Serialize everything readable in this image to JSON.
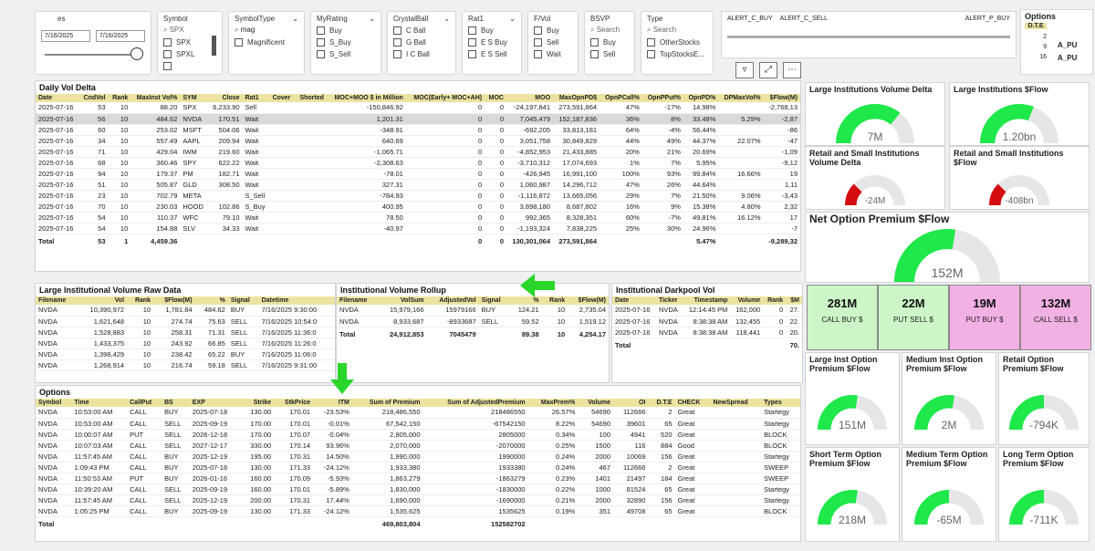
{
  "slicers": {
    "date": {
      "title": "es",
      "start": "7/16/2025",
      "end": "7/16/2025"
    },
    "symbol": {
      "title": "Symbol",
      "search": "SPX",
      "options": [
        "SPX",
        "SPXL"
      ]
    },
    "symbol_type": {
      "title": "SymbolType",
      "search": "mag",
      "options": [
        "Magnificent"
      ]
    },
    "my_rating": {
      "title": "MyRating",
      "options": [
        "Buy",
        "S_Buy",
        "S_Sell"
      ]
    },
    "crystal_ball": {
      "title": "CrystalBall",
      "options": [
        "C Ball",
        "G Ball",
        "I C Ball"
      ]
    },
    "rat1": {
      "title": "Rat1",
      "options": [
        "Buy",
        "E S Buy",
        "E S Sell"
      ]
    },
    "fvol": {
      "title": "F/Vol",
      "options": [
        "Buy",
        "Sell",
        "Wait"
      ]
    },
    "bsvp": {
      "title": "BSVP",
      "search": "Search",
      "options": [
        "Buy",
        "Sell"
      ]
    },
    "type": {
      "title": "Type",
      "search": "Search",
      "options": [
        "OtherStocks",
        "TopStocksE..."
      ]
    },
    "alerts": {
      "a": "ALERT_C_BUY",
      "b": "ALERT_C_SELL",
      "c": "ALERT_P_BUY"
    },
    "options_slicer": {
      "title": "Options",
      "header": "D.T.E",
      "values": [
        "2",
        "9",
        "16"
      ],
      "side": [
        "A_PU",
        "A_PU"
      ]
    }
  },
  "daily_vol_delta": {
    "title": "Daily Vol Delta",
    "columns": [
      "Date",
      "CndVol",
      "Rank",
      "MaxInst Vol%",
      "SYM",
      "Close",
      "Rat1",
      "Cover",
      "Shorted",
      "MOC+MOO $ in Million",
      "MOC(Early+ MOC+AH)",
      "MOC",
      "MOO",
      "MaxOpnPD$",
      "OpnPCall%",
      "OpnPPut%",
      "OpnPD%",
      "DPMaxVol%",
      "$Flow(M)"
    ],
    "rows": [
      [
        "2025-07-16",
        "53",
        "10",
        "88.20",
        "SPX",
        "6,233.90",
        "Sell",
        "",
        "",
        "-150,846.92",
        "0",
        "0",
        "-24,197,841",
        "273,591,864",
        "47%",
        "-17%",
        "14.98%",
        "",
        "-2,768,13"
      ],
      [
        "2025-07-16",
        "56",
        "10",
        "484.62",
        "NVDA",
        "170.51",
        "Wait",
        "",
        "",
        "1,201.31",
        "0",
        "0",
        "7,045,479",
        "152,187,836",
        "36%",
        "8%",
        "33.48%",
        "5.29%",
        "-2,87"
      ],
      [
        "2025-07-16",
        "60",
        "10",
        "253.02",
        "MSFT",
        "504.06",
        "Wait",
        "",
        "",
        "-348.91",
        "0",
        "0",
        "-692,205",
        "33,813,181",
        "64%",
        "-4%",
        "56.44%",
        "",
        "-86"
      ],
      [
        "2025-07-16",
        "34",
        "10",
        "557.49",
        "AAPL",
        "209.94",
        "Wait",
        "",
        "",
        "640.69",
        "0",
        "0",
        "3,051,758",
        "30,849,829",
        "44%",
        "49%",
        "44.37%",
        "22.07%",
        "-47"
      ],
      [
        "2025-07-16",
        "71",
        "10",
        "429.04",
        "IWM",
        "219.60",
        "Wait",
        "",
        "",
        "-1,065.71",
        "0",
        "0",
        "-4,852,953",
        "21,433,885",
        "20%",
        "21%",
        "20.69%",
        "",
        "-1,09"
      ],
      [
        "2025-07-16",
        "68",
        "10",
        "360.46",
        "SPY",
        "622.22",
        "Wait",
        "",
        "",
        "-2,308.63",
        "0",
        "0",
        "-3,710,312",
        "17,074,693",
        "1%",
        "7%",
        "5.95%",
        "",
        "-9,12"
      ],
      [
        "2025-07-16",
        "94",
        "10",
        "179.37",
        "PM",
        "182.71",
        "Wait",
        "",
        "",
        "-78.01",
        "0",
        "0",
        "-426,945",
        "16,991,100",
        "100%",
        "93%",
        "99.84%",
        "16.66%",
        "19"
      ],
      [
        "2025-07-16",
        "51",
        "10",
        "505.87",
        "GLD",
        "308.50",
        "Wait",
        "",
        "",
        "327.31",
        "0",
        "0",
        "1,060,987",
        "14,296,712",
        "47%",
        "26%",
        "44.64%",
        "",
        "1,11"
      ],
      [
        "2025-07-16",
        "23",
        "10",
        "702.79",
        "META",
        "",
        "S_Sell",
        "",
        "",
        "-784.93",
        "0",
        "0",
        "-1,116,872",
        "13,665,056",
        "29%",
        "7%",
        "21.50%",
        "9.06%",
        "-3,43"
      ],
      [
        "2025-07-16",
        "70",
        "10",
        "230.03",
        "HOOD",
        "102.86",
        "S_Buy",
        "",
        "",
        "400.95",
        "0",
        "0",
        "3,898,180",
        "8,687,802",
        "16%",
        "9%",
        "15.38%",
        "4.80%",
        "2,32"
      ],
      [
        "2025-07-16",
        "54",
        "10",
        "110.37",
        "WFC",
        "79.10",
        "Wait",
        "",
        "",
        "78.50",
        "0",
        "0",
        "992,365",
        "8,328,351",
        "60%",
        "-7%",
        "49.81%",
        "16.12%",
        "17"
      ],
      [
        "2025-07-16",
        "54",
        "10",
        "154.88",
        "SLV",
        "34.33",
        "Wait",
        "",
        "",
        "-40.97",
        "0",
        "0",
        "-1,193,324",
        "7,838,225",
        "25%",
        "30%",
        "24.96%",
        "",
        "-7"
      ]
    ],
    "total": [
      "Total",
      "53",
      "1",
      "4,459.36",
      "",
      "",
      "",
      "",
      "",
      "",
      "0",
      "0",
      "130,301,064",
      "273,591,864",
      "",
      "",
      "5.47%",
      "",
      "-9,289,32"
    ]
  },
  "large_inst_raw": {
    "title": "Large Institutional Volume Raw Data",
    "columns": [
      "Filename",
      "Vol",
      "Rank",
      "$Flow(M)",
      "%",
      "Signal",
      "Datetime"
    ],
    "rows": [
      [
        "NVDA",
        "10,390,972",
        "10",
        "1,781.84",
        "484.62",
        "BUY",
        "7/16/2025 9:30:00"
      ],
      [
        "NVDA",
        "1,621,648",
        "10",
        "274.74",
        "75.63",
        "SELL",
        "7/16/2025 10:54:0"
      ],
      [
        "NVDA",
        "1,528,883",
        "10",
        "258.31",
        "71.31",
        "SELL",
        "7/16/2025 11:36:0"
      ],
      [
        "NVDA",
        "1,433,375",
        "10",
        "243.92",
        "66.85",
        "SELL",
        "7/16/2025 11:26:0"
      ],
      [
        "NVDA",
        "1,398,429",
        "10",
        "238.42",
        "65.22",
        "BUY",
        "7/16/2025 11:06:0"
      ],
      [
        "NVDA",
        "1,268,914",
        "10",
        "216.74",
        "59.18",
        "SELL",
        "7/16/2025 9:31:00"
      ]
    ]
  },
  "inst_rollup": {
    "title": "Institutional Volume Rollup",
    "columns": [
      "Filename",
      "VolSum",
      "AdjustedVol",
      "Signal",
      "%",
      "Rank",
      "$Flow(M)"
    ],
    "rows": [
      [
        "NVDA",
        "15,979,166",
        "15979166",
        "BUY",
        "124.21",
        "10",
        "2,735.04"
      ],
      [
        "NVDA",
        "8,933,687",
        "-8933687",
        "SELL",
        "59.52",
        "10",
        "1,519.12"
      ]
    ],
    "total": [
      "Total",
      "24,912,853",
      "7045479",
      "",
      "89.38",
      "10",
      "4,254.17"
    ]
  },
  "darkpool": {
    "title": "Institutional Darkpool Vol",
    "columns": [
      "Date",
      "Ticker",
      "Timestamp",
      "Volume",
      "Rank",
      "$M"
    ],
    "rows": [
      [
        "2025-07-16",
        "NVDA",
        "12:14:45 PM",
        "162,000",
        "0",
        "27."
      ],
      [
        "2025-07-16",
        "NVDA",
        "8:38:38 AM",
        "132,455",
        "0",
        "22."
      ],
      [
        "2025-07-16",
        "NVDA",
        "8:38:38 AM",
        "118,441",
        "0",
        "20."
      ]
    ],
    "total": [
      "Total",
      "",
      "",
      "",
      "",
      "70."
    ]
  },
  "options_table": {
    "title": "Options",
    "columns": [
      "Symbol",
      "Time",
      "CallPut",
      "BS",
      "EXP",
      "Strike",
      "StkPrice",
      "ITM",
      "Sum of Premium",
      "Sum of AdjustedPremium",
      "MaxPrem%",
      "Volume",
      "OI",
      "D.T.E",
      "CHECK",
      "NewSpread",
      "Types"
    ],
    "rows": [
      [
        "NVDA",
        "10:53:00 AM",
        "CALL",
        "BUY",
        "2025-07-18",
        "130.00",
        "170.01",
        "-23.53%",
        "218,486,550",
        "218486550",
        "26.57%",
        "54690",
        "112666",
        "2",
        "Great",
        "",
        "Startegy"
      ],
      [
        "NVDA",
        "10:53:00 AM",
        "CALL",
        "SELL",
        "2025-09-19",
        "170.00",
        "170.01",
        "-0.01%",
        "67,542,150",
        "-67542150",
        "8.22%",
        "54690",
        "39601",
        "65",
        "Great",
        "",
        "Startegy"
      ],
      [
        "NVDA",
        "10:00:07 AM",
        "PUT",
        "SELL",
        "2026-12-18",
        "170.00",
        "170.07",
        "-0.04%",
        "2,805,000",
        "2805000",
        "0.34%",
        "100",
        "4941",
        "520",
        "Great",
        "",
        "BLOCK"
      ],
      [
        "NVDA",
        "10:07:03 AM",
        "CALL",
        "SELL",
        "2027-12-17",
        "330.00",
        "170.14",
        "93.96%",
        "2,070,000",
        "-2070000",
        "0.25%",
        "1500",
        "116",
        "884",
        "Good",
        "",
        "BLOCK"
      ],
      [
        "NVDA",
        "11:57:45 AM",
        "CALL",
        "BUY",
        "2025-12-19",
        "195.00",
        "170.31",
        "14.50%",
        "1,990,000",
        "1990000",
        "0.24%",
        "2000",
        "10069",
        "156",
        "Great",
        "",
        "Startegy"
      ],
      [
        "NVDA",
        "1:09:43 PM",
        "CALL",
        "BUY",
        "2025-07-18",
        "130.00",
        "171.33",
        "-24.12%",
        "1,933,380",
        "1933380",
        "0.24%",
        "467",
        "112666",
        "2",
        "Great",
        "",
        "SWEEP"
      ],
      [
        "NVDA",
        "11:50:53 AM",
        "PUT",
        "BUY",
        "2026-01-16",
        "160.00",
        "170.09",
        "-5.93%",
        "1,863,279",
        "-1863279",
        "0.23%",
        "1401",
        "21497",
        "184",
        "Great",
        "",
        "SWEEP"
      ],
      [
        "NVDA",
        "10:39:20 AM",
        "CALL",
        "SELL",
        "2025-09-19",
        "160.00",
        "170.01",
        "-5.89%",
        "1,830,000",
        "-1830000",
        "0.22%",
        "1000",
        "81524",
        "65",
        "Great",
        "",
        "Startegy"
      ],
      [
        "NVDA",
        "11:57:45 AM",
        "CALL",
        "SELL",
        "2025-12-19",
        "200.00",
        "170.31",
        "17.44%",
        "1,690,000",
        "-1690000",
        "0.21%",
        "2000",
        "32890",
        "156",
        "Great",
        "",
        "Startegy"
      ],
      [
        "NVDA",
        "1:05:25 PM",
        "CALL",
        "BUY",
        "2025-09-19",
        "130.00",
        "171.33",
        "-24.12%",
        "1,535,625",
        "1535625",
        "0.19%",
        "351",
        "49708",
        "65",
        "Great",
        "",
        "BLOCK"
      ]
    ],
    "total": [
      "Total",
      "",
      "",
      "",
      "",
      "",
      "",
      "",
      "469,803,804",
      "152582702",
      "",
      "",
      "",
      "",
      "",
      "",
      ""
    ]
  },
  "kpis": {
    "large_inst_vol_delta": {
      "title": "Large Institutions Volume Delta",
      "value": "7M",
      "fraction": 0.72,
      "color": "#1fe84a"
    },
    "large_inst_flow": {
      "title": "Large Institutions $Flow",
      "value": "1.20bn",
      "fraction": 0.62,
      "color": "#1fe84a"
    },
    "retail_vol_delta": {
      "title": "Retail and Small Institutions Volume Delta",
      "value": "-24M",
      "fraction": 0.25,
      "color": "#d40d12"
    },
    "retail_flow": {
      "title": "Retail and Small Institutions $Flow",
      "value": "-408bn",
      "fraction": 0.25,
      "color": "#d40d12"
    },
    "net_option": {
      "title": "Net Option Premium $Flow",
      "value": "152M",
      "fraction": 0.55,
      "color": "#1fe84a"
    },
    "large_inst_option": {
      "title": "Large Inst Option Premium $Flow",
      "value": "151M",
      "fraction": 0.55,
      "color": "#1fe84a"
    },
    "medium_inst_option": {
      "title": "Medium Inst Option Premium $Flow",
      "value": "2M",
      "fraction": 0.55,
      "color": "#1fe84a"
    },
    "retail_option": {
      "title": "Retail Option Premium $Flow",
      "value": "-794K",
      "fraction": 0.5,
      "color": "#1fe84a"
    },
    "short_term_option": {
      "title": "Short Term Option Premium $Flow",
      "value": "218M",
      "fraction": 0.55,
      "color": "#1fe84a"
    },
    "medium_term_option": {
      "title": "Medium Term Option Premium $Flow",
      "value": "-65M",
      "fraction": 0.5,
      "color": "#1fe84a"
    },
    "long_term_option": {
      "title": "Long Term Option Premium $Flow",
      "value": "-711K",
      "fraction": 0.5,
      "color": "#1fe84a"
    }
  },
  "tiles": [
    {
      "value": "281M",
      "label": "CALL BUY $",
      "color": "#ccf5c8"
    },
    {
      "value": "22M",
      "label": "PUT SELL $",
      "color": "#ccf5c8"
    },
    {
      "value": "19M",
      "label": "PUT BUY $",
      "color": "#f2b1e4"
    },
    {
      "value": "132M",
      "label": "CALL SELL $",
      "color": "#f2b1e4"
    }
  ],
  "icons": {
    "back": "back-arrow-icon",
    "filter": "filter-icon",
    "focus": "focus-mode-icon",
    "more": "more-options-icon"
  }
}
